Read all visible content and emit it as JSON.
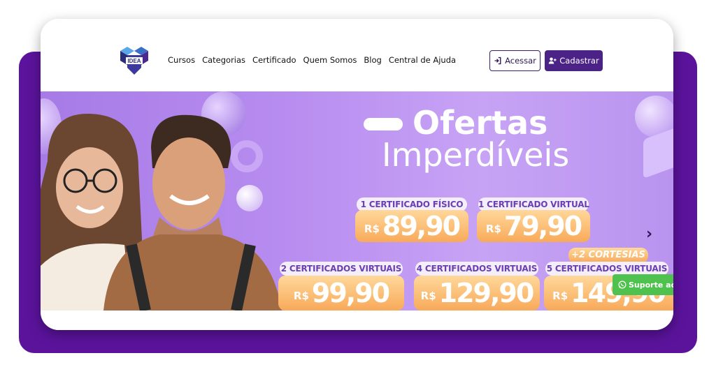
{
  "logo": {
    "text": "IDEA"
  },
  "nav": {
    "items": [
      "Cursos",
      "Categorias",
      "Certificado",
      "Quem Somos",
      "Blog",
      "Central de Ajuda"
    ]
  },
  "auth": {
    "login_label": "Acessar",
    "signup_label": "Cadastrar"
  },
  "banner": {
    "title_line1": "Ofertas",
    "title_line2": "Imperdíveis",
    "currency": "R$",
    "offers": [
      {
        "label": "1 CERTIFICADO FÍSICO",
        "price": "89,90"
      },
      {
        "label": "1 CERTIFICADO VIRTUAL",
        "price": "79,90"
      },
      {
        "label": "2 CERTIFICADOS VIRTUAIS",
        "price": "99,90"
      },
      {
        "label": "4 CERTIFICADOS VIRTUAIS",
        "price": "129,90"
      },
      {
        "label": "5 CERTIFICADOS VIRTUAIS",
        "price": "149,90"
      }
    ],
    "bonus": "+2 CORTESIAS",
    "next_arrow": "›"
  },
  "support": {
    "label": "Suporte ao A",
    "icon": "whatsapp-icon"
  },
  "colors": {
    "frame": "#5b139c",
    "brand": "#4b2387",
    "support": "#4fc14e"
  }
}
